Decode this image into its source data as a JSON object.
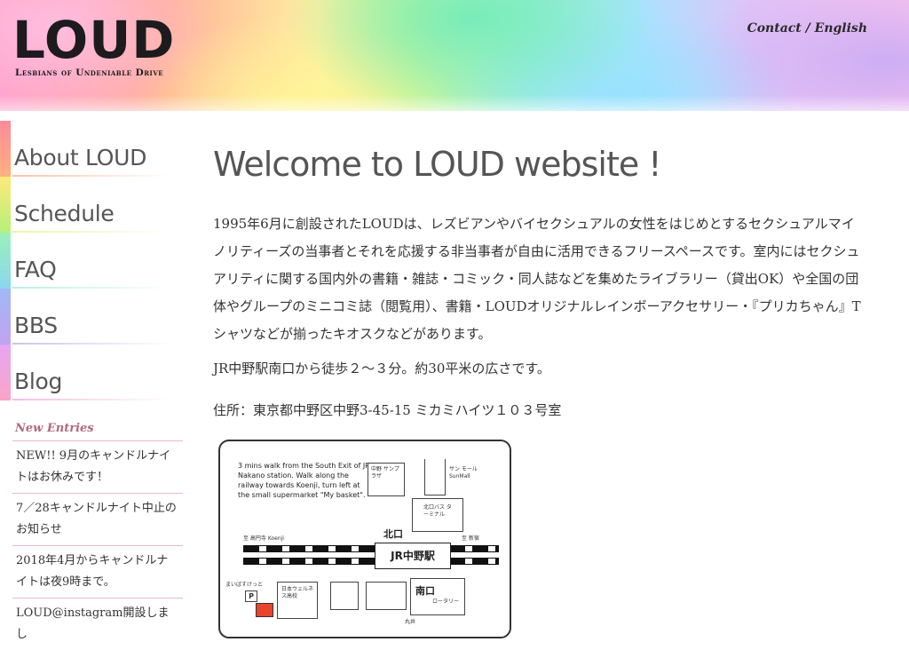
{
  "header": {
    "logo": "LOUD",
    "tagline": "Lesbians of Undeniable Drive",
    "links": [
      "Contact",
      "English"
    ],
    "link_separator": " / "
  },
  "nav": {
    "items": [
      {
        "label": "About LOUD",
        "color": "#ff8a9a"
      },
      {
        "label": "Schedule",
        "color": "#c9f27a"
      },
      {
        "label": "FAQ",
        "color": "#8fe7df"
      },
      {
        "label": "BBS",
        "color": "#a9a7f1"
      },
      {
        "label": "Blog",
        "color": "#f7a3e0"
      }
    ]
  },
  "sidebar": {
    "new_entries_title": "New Entries",
    "entries": [
      "NEW!! 9月のキャンドルナイトはお休みです！",
      "7／28キャンドルナイト中止のお知らせ",
      "2018年4月からキャンドルナイトは夜9時まで。",
      "LOUD@instagram開設しまし"
    ]
  },
  "main": {
    "title": "Welcome to LOUD website !",
    "intro": "1995年6月に創設されたLOUDは、レズビアンやバイセクシュアルの女性をはじめとするセクシュアルマイノリティーズの当事者とそれを応援する非当事者が自由に活用できるフリースペースです。室内にはセクシュアリティに関する国内外の書籍・雑誌・コミック・同人誌などを集めたライブラリー（貸出OK）や全国の団体やグループのミニコミ誌（閲覧用）、書籍・LOUDオリジナルレインボーアクセサリー・『プリカちゃん』Tシャツなどが揃ったキオスクなどがあります。",
    "access": "JR中野駅南口から徒歩２～３分。約30平米の広さです。",
    "address": "住所：東京都中野区中野3-45-15 ミカミハイツ１０３号室"
  },
  "map": {
    "note": "3 mins walk from the South Exit of JR Nakano station. Walk along the railway towards Koenji, turn left at the small supermarket \"My basket\".",
    "station": "JR中野駅",
    "north_exit": "北口",
    "south_exit": "南口",
    "nakano_sunplaza": "中野 サンプラザ",
    "sunmall": "サン モール SunMall",
    "north_bus": "北口バス ターミナル",
    "koenji": "至 高円寺 Koenji",
    "shinjuku": "至 新宿",
    "my_basket": "まいばすけっと",
    "parking": "P",
    "school": "日本ウェルネス高校",
    "rotary": "ロータリー",
    "marui": "丸井",
    "accent_color": "#e8452c"
  }
}
